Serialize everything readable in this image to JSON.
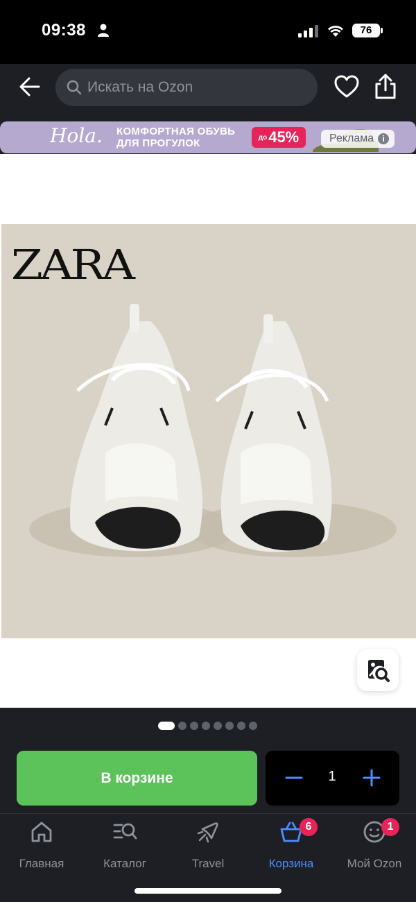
{
  "status_bar": {
    "time": "09:38",
    "battery": "76"
  },
  "header": {
    "search_placeholder": "Искать на Ozon"
  },
  "ad": {
    "logo": "Hola.",
    "text_line1": "КОМФОРТНАЯ ОБУВЬ",
    "text_line2": "ДЛЯ ПРОГУЛОК",
    "discount_prefix": "до",
    "discount_value": "45%",
    "label": "Реклама",
    "info_symbol": "i"
  },
  "product": {
    "brand_logo": "ZARA",
    "gallery_total": 8,
    "gallery_active_index": 0
  },
  "actions": {
    "cart_button": "В корзине",
    "quantity": "1"
  },
  "tabs": [
    {
      "label": "Главная",
      "icon": "home-icon"
    },
    {
      "label": "Каталог",
      "icon": "catalog-icon"
    },
    {
      "label": "Travel",
      "icon": "plane-icon"
    },
    {
      "label": "Корзина",
      "icon": "basket-icon",
      "badge": "6",
      "active": true
    },
    {
      "label": "Мой Ozon",
      "icon": "profile-icon",
      "badge": "1"
    }
  ],
  "colors": {
    "accent_blue": "#4c8dff",
    "cart_green": "#5cc35b",
    "badge_pink": "#e8235a",
    "ad_purple": "#b6a9cf",
    "dark_bg": "#1d1f24"
  }
}
